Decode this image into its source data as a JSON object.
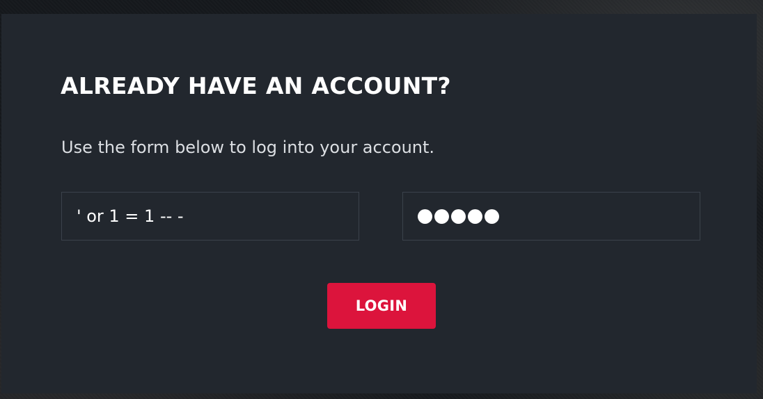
{
  "login_panel": {
    "title": "ALREADY HAVE AN ACCOUNT?",
    "subtitle": "Use the form below to log into your account.",
    "username_field": {
      "value": "' or 1 = 1 -- -"
    },
    "password_field": {
      "masked_length": 5
    },
    "login_button_label": "LOGIN"
  },
  "colors": {
    "panel_background": "#22272e",
    "field_border": "#3b424b",
    "button_accent": "#dc143c",
    "text": "#ffffff"
  }
}
